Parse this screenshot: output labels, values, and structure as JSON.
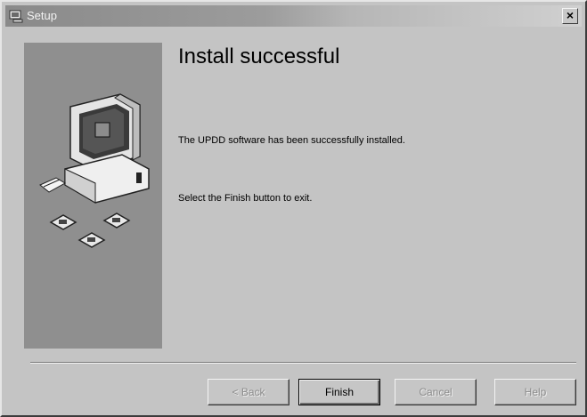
{
  "window": {
    "title": "Setup",
    "close_label": "×"
  },
  "main": {
    "heading": "Install successful",
    "message": "The UPDD software has been successfully installed.",
    "instruction": "Select the Finish button to exit."
  },
  "buttons": {
    "back": "< Back",
    "finish": "Finish",
    "cancel": "Cancel",
    "help": "Help"
  },
  "icons": {
    "title": "setup-app-icon",
    "side": "computer-with-disks-illustration"
  }
}
